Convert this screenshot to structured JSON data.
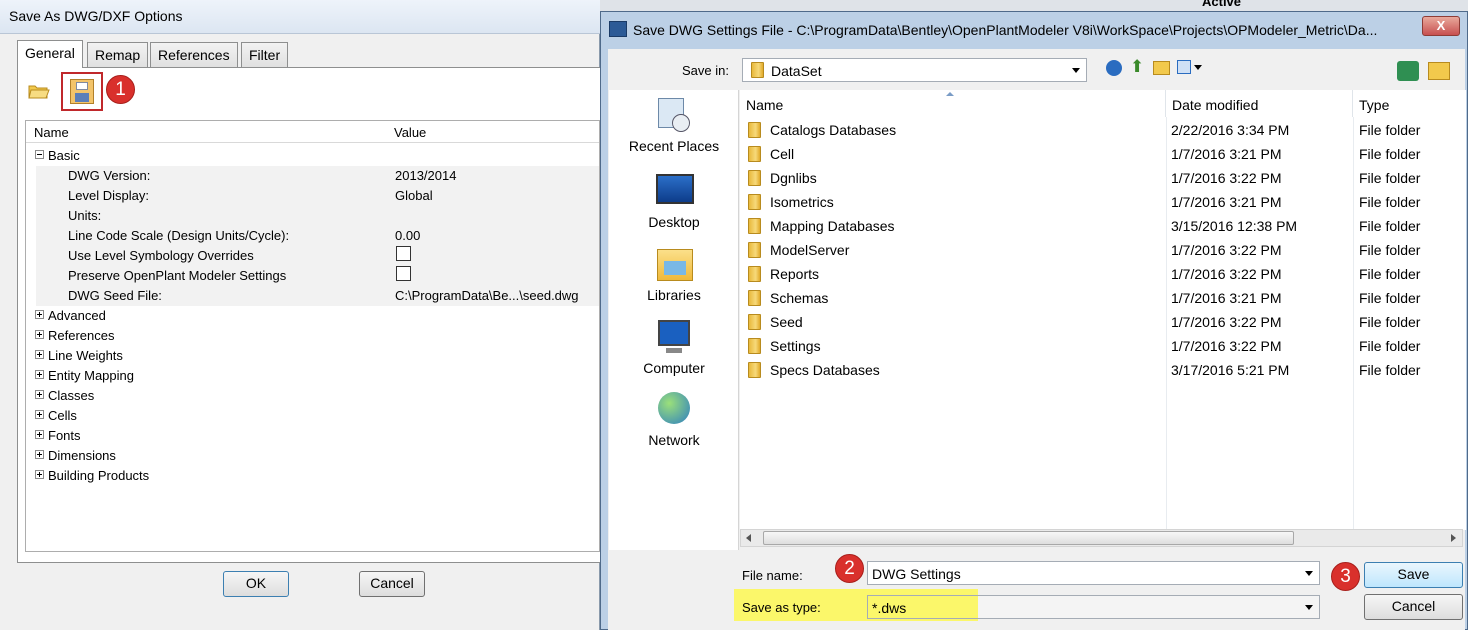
{
  "bg_window": {
    "title": "Save As DWG/DXF Options",
    "tabs": [
      "General",
      "Remap",
      "References",
      "Filter"
    ],
    "grid_headers": {
      "name": "Name",
      "value": "Value"
    },
    "basic_label": "Basic",
    "properties": [
      {
        "name": "DWG Version:",
        "value": "2013/2014"
      },
      {
        "name": "Level Display:",
        "value": "Global"
      },
      {
        "name": "Units:",
        "value": ""
      },
      {
        "name": "Line Code Scale (Design Units/Cycle):",
        "value": "0.00"
      },
      {
        "name": "Use Level Symbology Overrides",
        "value": ""
      },
      {
        "name": "Preserve OpenPlant Modeler Settings",
        "value": ""
      },
      {
        "name": "DWG Seed File:",
        "value": "C:\\ProgramData\\Be...\\seed.dwg"
      }
    ],
    "groups": [
      "Advanced",
      "References",
      "Line Weights",
      "Entity Mapping",
      "Classes",
      "Cells",
      "Fonts",
      "Dimensions",
      "Building Products"
    ],
    "ok_label": "OK",
    "cancel_label": "Cancel",
    "partial_text_top": "Active"
  },
  "badges": [
    "1",
    "2",
    "3"
  ],
  "dialog": {
    "title": "Save DWG Settings File - C:\\ProgramData\\Bentley\\OpenPlantModeler V8i\\WorkSpace\\Projects\\OPModeler_Metric\\Da...",
    "close_label": "X",
    "save_in_label": "Save in:",
    "save_in_value": "DataSet",
    "places": [
      "Recent Places",
      "Desktop",
      "Libraries",
      "Computer",
      "Network"
    ],
    "columns": {
      "name": "Name",
      "date": "Date modified",
      "type": "Type"
    },
    "files": [
      {
        "name": "Catalogs Databases",
        "date": "2/22/2016 3:34 PM",
        "type": "File folder"
      },
      {
        "name": "Cell",
        "date": "1/7/2016 3:21 PM",
        "type": "File folder"
      },
      {
        "name": "Dgnlibs",
        "date": "1/7/2016 3:22 PM",
        "type": "File folder"
      },
      {
        "name": "Isometrics",
        "date": "1/7/2016 3:21 PM",
        "type": "File folder"
      },
      {
        "name": "Mapping Databases",
        "date": "3/15/2016 12:38 PM",
        "type": "File folder"
      },
      {
        "name": "ModelServer",
        "date": "1/7/2016 3:22 PM",
        "type": "File folder"
      },
      {
        "name": "Reports",
        "date": "1/7/2016 3:22 PM",
        "type": "File folder"
      },
      {
        "name": "Schemas",
        "date": "1/7/2016 3:21 PM",
        "type": "File folder"
      },
      {
        "name": "Seed",
        "date": "1/7/2016 3:22 PM",
        "type": "File folder"
      },
      {
        "name": "Settings",
        "date": "1/7/2016 3:22 PM",
        "type": "File folder"
      },
      {
        "name": "Specs Databases",
        "date": "3/17/2016 5:21 PM",
        "type": "File folder"
      }
    ],
    "file_name_label": "File name:",
    "file_name_value": "DWG Settings",
    "save_type_label": "Save as type:",
    "save_type_value": "*.dws",
    "save_label": "Save",
    "cancel_label": "Cancel"
  },
  "colors": {
    "badge": "#d9302c",
    "highlight": "#fbf76a",
    "selection_border": "#c0282b"
  }
}
